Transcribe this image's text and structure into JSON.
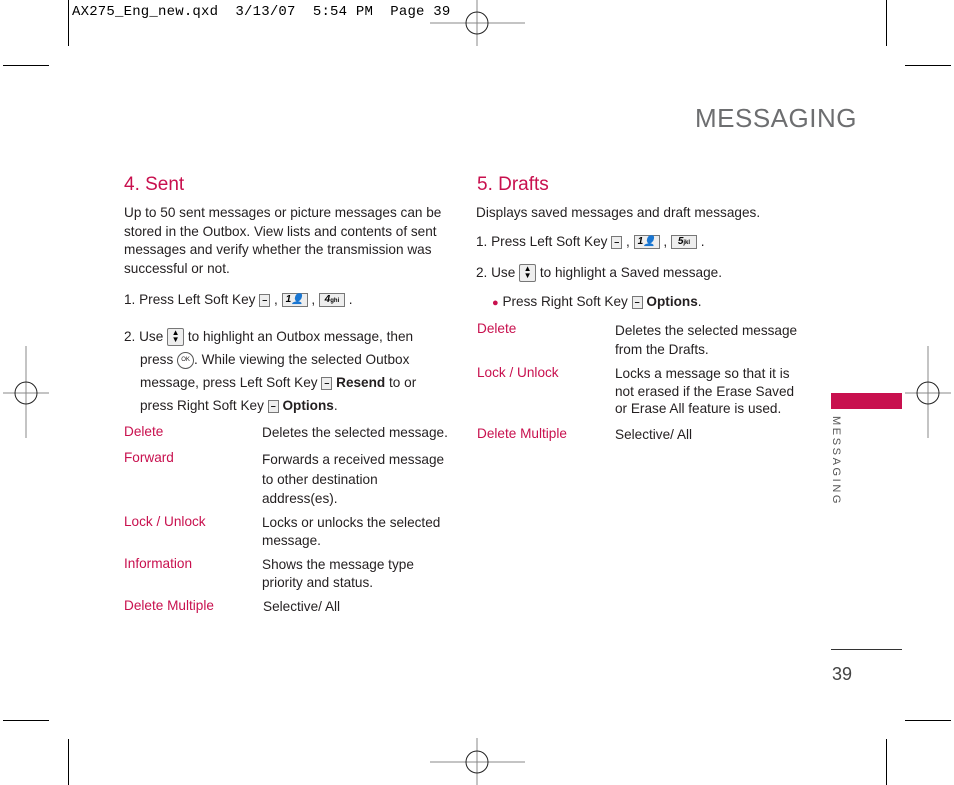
{
  "slug": "AX275_Eng_new.qxd  3/13/07  5:54 PM  Page 39",
  "section_title": "MESSAGING",
  "side_tab_label": "MESSAGING",
  "page_number": "39",
  "colors": {
    "accent": "#c8104e",
    "title_gray": "#6d6e70",
    "text": "#231f20"
  },
  "sent": {
    "heading": "4. Sent",
    "intro": [
      "Up to 50 sent messages or picture messages can be",
      "stored in the Outbox. View lists and contents of sent",
      "messages and verify whether the transmission was",
      "successful or not."
    ],
    "step1_prefix": "1. Press Left Soft Key",
    "step1_keys": [
      "1",
      "4"
    ],
    "step1_key_subs": [
      "",
      "ghi"
    ],
    "step2": {
      "l1a": "2. Use",
      "l1b": "to highlight an Outbox message, then",
      "l2a": "press",
      "l2b": ". While viewing the selected Outbox",
      "l3a": "message, press Left Soft Key",
      "l3b": "Resend",
      "l3c": "to or",
      "l4a": "press Right Soft Key",
      "l4b": "Options",
      "l4c": "."
    },
    "options": [
      {
        "term": "Delete",
        "def": [
          "Deletes the selected message."
        ]
      },
      {
        "term": "Forward",
        "def": [
          "Forwards a received message",
          "to other destination",
          "address(es)."
        ]
      },
      {
        "term": "Lock / Unlock",
        "def": [
          "Locks or unlocks the selected",
          "message."
        ]
      },
      {
        "term": "Information",
        "def": [
          "Shows the message type",
          "priority and status."
        ]
      },
      {
        "term": "Delete Multiple",
        "def": [
          "Selective/ All"
        ]
      }
    ]
  },
  "drafts": {
    "heading": "5. Drafts",
    "intro": "Displays saved messages and draft messages.",
    "step1_prefix": "1. Press Left Soft Key",
    "step1_keys": [
      "1",
      "5"
    ],
    "step1_key_subs": [
      "",
      "jkl"
    ],
    "step2a": "2. Use",
    "step2b": "to highlight a Saved message.",
    "bullet_a": "Press Right Soft Key",
    "bullet_b": "Options",
    "bullet_c": ".",
    "options": [
      {
        "term": "Delete",
        "def": [
          "Deletes the selected message",
          "from the Drafts."
        ]
      },
      {
        "term": "Lock / Unlock",
        "def": [
          "Locks a message so that it is",
          "not erased if the Erase Saved",
          "or Erase All feature is used."
        ]
      },
      {
        "term": "Delete Multiple",
        "def": [
          "Selective/ All"
        ]
      }
    ]
  },
  "key_labels": {
    "soft": "–",
    "nav": "⌃⌄",
    "ok": "OK"
  }
}
